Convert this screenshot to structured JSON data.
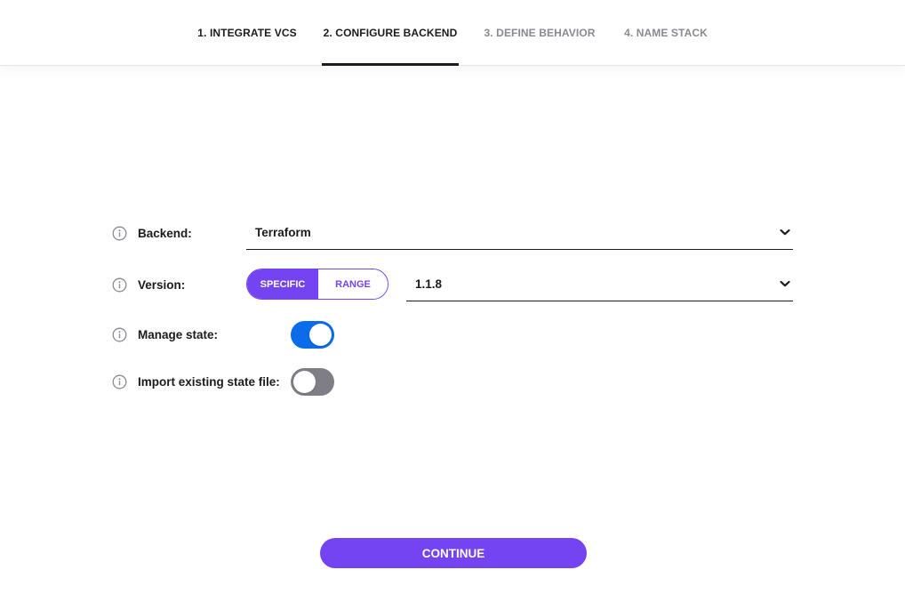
{
  "stepper": {
    "tabs": [
      {
        "label": "1. INTEGRATE VCS",
        "state": "done"
      },
      {
        "label": "2. CONFIGURE BACKEND",
        "state": "active"
      },
      {
        "label": "3. DEFINE BEHAVIOR",
        "state": "pending"
      },
      {
        "label": "4. NAME STACK",
        "state": "pending"
      }
    ]
  },
  "form": {
    "backend": {
      "label": "Backend:",
      "value": "Terraform",
      "icon": "info-icon"
    },
    "version": {
      "label": "Version:",
      "icon": "info-icon",
      "mode_options": [
        "SPECIFIC",
        "RANGE"
      ],
      "selected_mode": "SPECIFIC",
      "value": "1.1.8"
    },
    "manage_state": {
      "label": "Manage state:",
      "icon": "info-icon",
      "enabled": true
    },
    "import_state": {
      "label": "Import existing state file:",
      "icon": "info-icon",
      "enabled": false
    }
  },
  "actions": {
    "continue_label": "CONTINUE"
  },
  "colors": {
    "accent": "#7443f2",
    "toggle_on": "#0a6cea",
    "toggle_off": "#7f7e87",
    "text": "#1b1b1f",
    "muted_tab": "#8a8992"
  }
}
